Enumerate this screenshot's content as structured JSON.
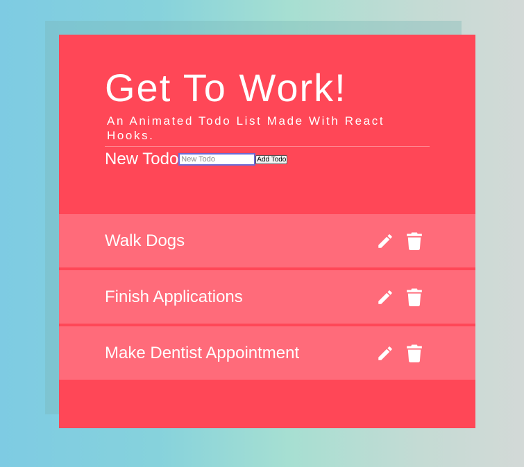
{
  "header": {
    "title": "Get To Work!",
    "subtitle": "An Animated Todo List Made With React Hooks."
  },
  "form": {
    "label": "New Todo",
    "input_placeholder": "New Todo",
    "input_value": "",
    "add_button_label": "Add Todo"
  },
  "todos": [
    {
      "text": "Walk Dogs",
      "edit_icon": "pencil-icon",
      "delete_icon": "trash-icon"
    },
    {
      "text": "Finish Applications",
      "edit_icon": "pencil-icon",
      "delete_icon": "trash-icon"
    },
    {
      "text": "Make Dentist Appointment",
      "edit_icon": "pencil-icon",
      "delete_icon": "trash-icon"
    }
  ],
  "colors": {
    "card_background": "#ff4757",
    "todo_background": "#ff6b7a",
    "text": "#ffffff"
  }
}
